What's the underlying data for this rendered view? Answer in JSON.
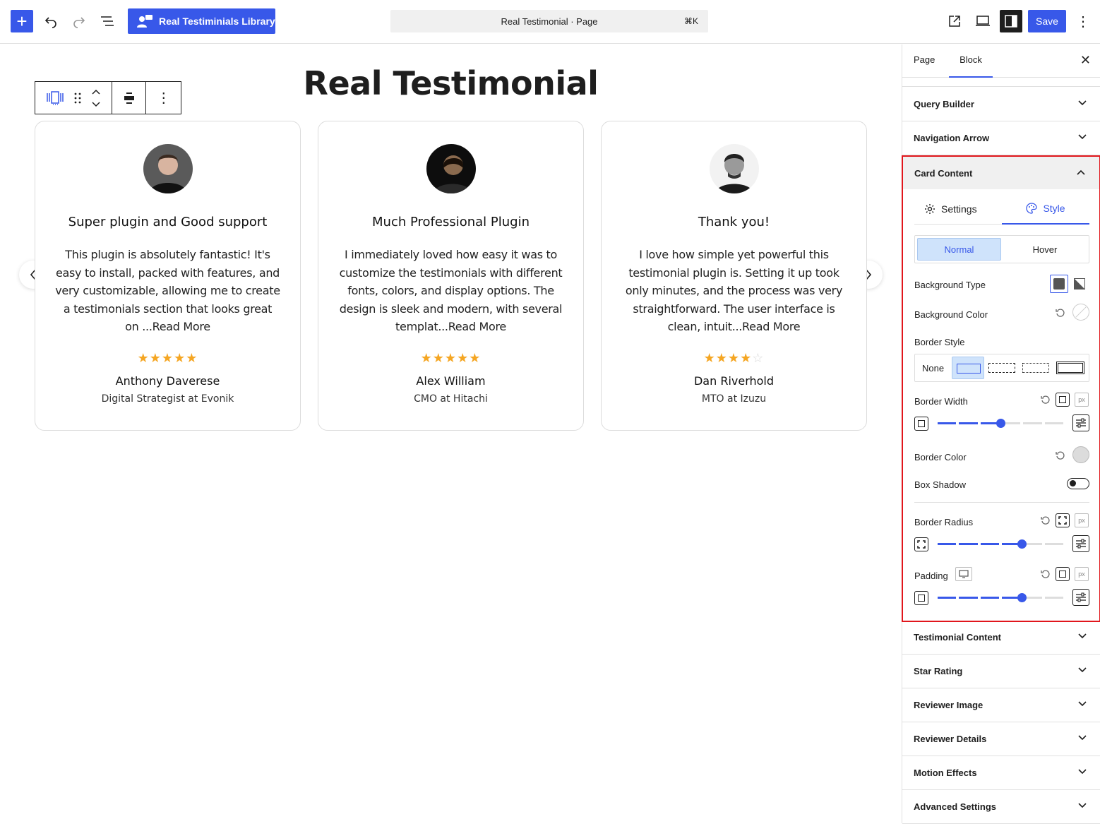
{
  "toolbar": {
    "library_label": "Real Testiminials Library",
    "document_title": "Real Testimonial · Page",
    "shortcut": "⌘K",
    "save_label": "Save",
    "accent": "#3858e9"
  },
  "page": {
    "title": "Real Testimonial"
  },
  "testimonials": [
    {
      "title": "Super plugin and Good support",
      "text": "This plugin is absolutely fantastic! It's easy to install, packed with features, and very customizable, allowing me to create a testimonials section that looks great on ...Read More",
      "rating": 5,
      "name": "Anthony Daverese",
      "role": "Digital Strategist at Evonik"
    },
    {
      "title": "Much Professional Plugin",
      "text": "I immediately loved how easy it was to customize the testimonials with different fonts, colors, and display options. The design is sleek and modern, with several templat...Read More",
      "rating": 5,
      "name": "Alex William",
      "role": "CMO at Hitachi"
    },
    {
      "title": "Thank you!",
      "text": "I love how simple yet powerful this testimonial plugin is. Setting it up took only minutes, and the process was very straightforward. The user interface is clean, intuit...Read More",
      "rating": 4,
      "name": "Dan Riverhold",
      "role": "MTO at Izuzu"
    }
  ],
  "sidebar": {
    "tabs": [
      "Page",
      "Block"
    ],
    "active_tab": "Block",
    "sections_top": [
      "Query Builder",
      "Navigation Arrow"
    ],
    "card_content": {
      "title": "Card Content",
      "tabs": [
        "Settings",
        "Style"
      ],
      "active_tab": "Style",
      "states": [
        "Normal",
        "Hover"
      ],
      "active_state": "Normal",
      "background_type_label": "Background Type",
      "background_color_label": "Background Color",
      "border_style_label": "Border Style",
      "border_style_none": "None",
      "border_width_label": "Border Width",
      "border_width_value": 0.5,
      "border_color_label": "Border Color",
      "box_shadow_label": "Box Shadow",
      "box_shadow_on": false,
      "border_radius_label": "Border Radius",
      "border_radius_value": 0.67,
      "padding_label": "Padding",
      "padding_value": 0.67,
      "unit": "px"
    },
    "sections_bottom": [
      "Testimonial Content",
      "Star Rating",
      "Reviewer Image",
      "Reviewer Details",
      "Motion Effects",
      "Advanced Settings"
    ],
    "highlight_color": "#e1161c"
  }
}
